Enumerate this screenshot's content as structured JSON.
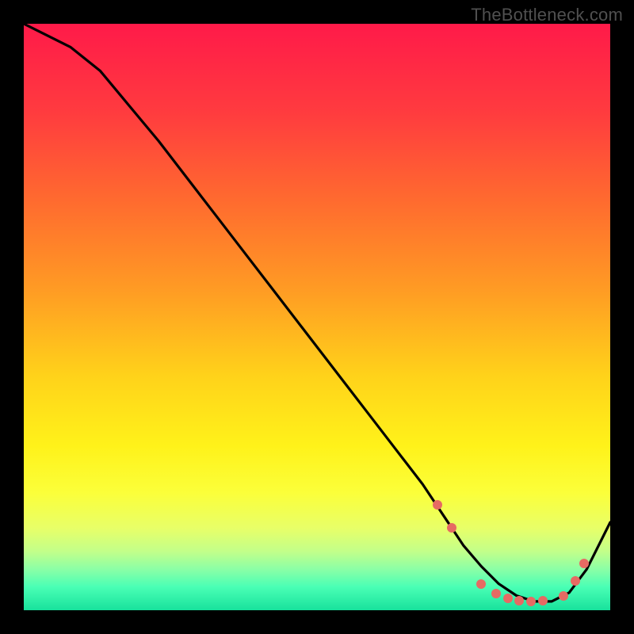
{
  "watermark": "TheBottleneck.com",
  "chart_data": {
    "type": "line",
    "title": "",
    "xlabel": "",
    "ylabel": "",
    "xlim": [
      0,
      100
    ],
    "ylim": [
      0,
      100
    ],
    "grid": false,
    "series": [
      {
        "name": "curve",
        "x": [
          0,
          3,
          8,
          13,
          18,
          23,
          28,
          33,
          38,
          43,
          48,
          53,
          58,
          63,
          68,
          72,
          75,
          78,
          81,
          84,
          87,
          90,
          93,
          96,
          100
        ],
        "y": [
          100,
          98.5,
          96,
          92,
          86,
          80,
          73.5,
          67,
          60.5,
          54,
          47.5,
          41,
          34.5,
          28,
          21.5,
          15.5,
          11,
          7.5,
          4.5,
          2.5,
          1.5,
          1.5,
          3,
          7,
          15
        ]
      }
    ],
    "markers": {
      "name": "dots",
      "color": "#e66a63",
      "x": [
        70.5,
        73,
        78,
        80.5,
        82.5,
        84.5,
        86.5,
        88.5,
        92,
        94,
        95.5
      ],
      "y": [
        18,
        14,
        4.5,
        2.8,
        2,
        1.6,
        1.5,
        1.6,
        2.5,
        5,
        8
      ]
    },
    "background_gradient": {
      "stops": [
        {
          "pos": 0.0,
          "color": "#ff1a49"
        },
        {
          "pos": 0.15,
          "color": "#ff3b3f"
        },
        {
          "pos": 0.3,
          "color": "#ff6a2f"
        },
        {
          "pos": 0.45,
          "color": "#ff9a24"
        },
        {
          "pos": 0.6,
          "color": "#ffd21a"
        },
        {
          "pos": 0.72,
          "color": "#fff21a"
        },
        {
          "pos": 0.8,
          "color": "#fbff3a"
        },
        {
          "pos": 0.86,
          "color": "#e8ff68"
        },
        {
          "pos": 0.9,
          "color": "#c2ff8a"
        },
        {
          "pos": 0.93,
          "color": "#8bffa6"
        },
        {
          "pos": 0.96,
          "color": "#4affb5"
        },
        {
          "pos": 1.0,
          "color": "#18e29c"
        }
      ]
    }
  }
}
